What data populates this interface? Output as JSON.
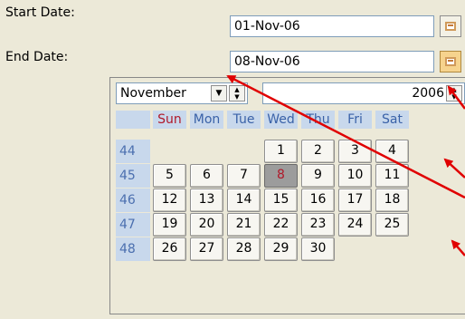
{
  "form": {
    "start_label": "Start Date:",
    "start_value": "01-Nov-06",
    "end_label": "End Date:",
    "end_value": "08-Nov-06"
  },
  "picker": {
    "month": "November",
    "year": "2006",
    "day_headers": [
      "Sun",
      "Mon",
      "Tue",
      "Wed",
      "Thu",
      "Fri",
      "Sat"
    ],
    "weeks": [
      {
        "num": "44",
        "days": [
          "",
          "",
          "",
          "1",
          "2",
          "3",
          "4"
        ]
      },
      {
        "num": "45",
        "days": [
          "5",
          "6",
          "7",
          "8",
          "9",
          "10",
          "11"
        ]
      },
      {
        "num": "46",
        "days": [
          "12",
          "13",
          "14",
          "15",
          "16",
          "17",
          "18"
        ]
      },
      {
        "num": "47",
        "days": [
          "19",
          "20",
          "21",
          "22",
          "23",
          "24",
          "25"
        ]
      },
      {
        "num": "48",
        "days": [
          "26",
          "27",
          "28",
          "29",
          "30",
          "",
          ""
        ]
      }
    ],
    "today": "8"
  },
  "colors": {
    "annotation_arrow": "#E00000",
    "today_text": "#B0192A",
    "header_bg": "#C8D8EC"
  },
  "icons": {
    "calendar_button": "calendar-icon",
    "month_dropdown": "chevron-down-icon",
    "spinner": "spin-updown-icon"
  }
}
